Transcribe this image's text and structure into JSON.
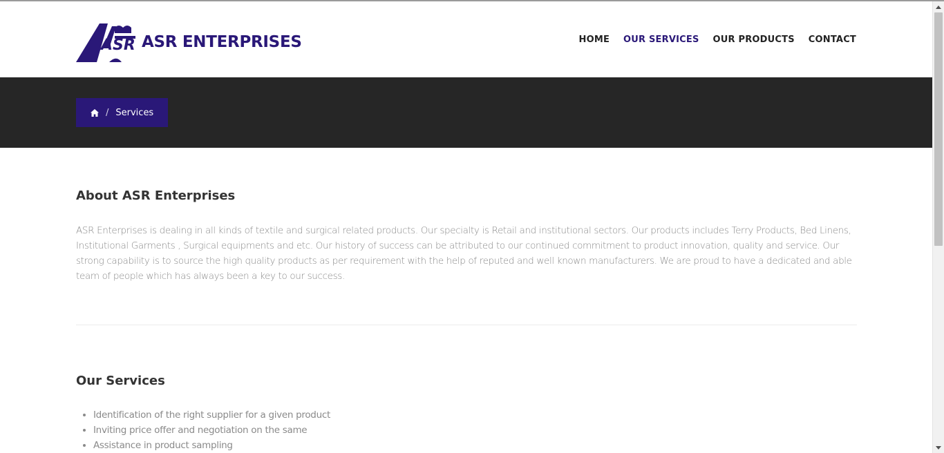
{
  "brand": {
    "name": "ASR ENTERPRISES",
    "color": "#2a1878"
  },
  "nav": {
    "items": [
      {
        "label": "HOME",
        "active": false
      },
      {
        "label": "OUR SERVICES",
        "active": true
      },
      {
        "label": "OUR PRODUCTS",
        "active": false
      },
      {
        "label": "CONTACT",
        "active": false
      }
    ]
  },
  "breadcrumb": {
    "home_icon": "home-icon",
    "separator": "/",
    "current": "Services"
  },
  "about": {
    "title": "About ASR Enterprises",
    "text": "ASR Enterprises is dealing in all kinds of textile and surgical related products. Our specialty is Retail and institutional sectors. Our products includes Terry Products, Bed Linens, Institutional Garments , Surgical equipments and etc. Our history of success can be attributed to our continued commitment to product innovation, quality and service. Our strong capability is to source the high quality products as per requirement with the help of reputed and well known manufacturers. We are proud to have a dedicated and able team of people which has always been a key to our success."
  },
  "services": {
    "title": "Our Services",
    "items": [
      "Identification of the right supplier for a given product",
      "Inviting price offer and negotiation on the same",
      "Assistance in product sampling"
    ]
  },
  "colors": {
    "band": "#262626",
    "accent": "#2a1878"
  }
}
